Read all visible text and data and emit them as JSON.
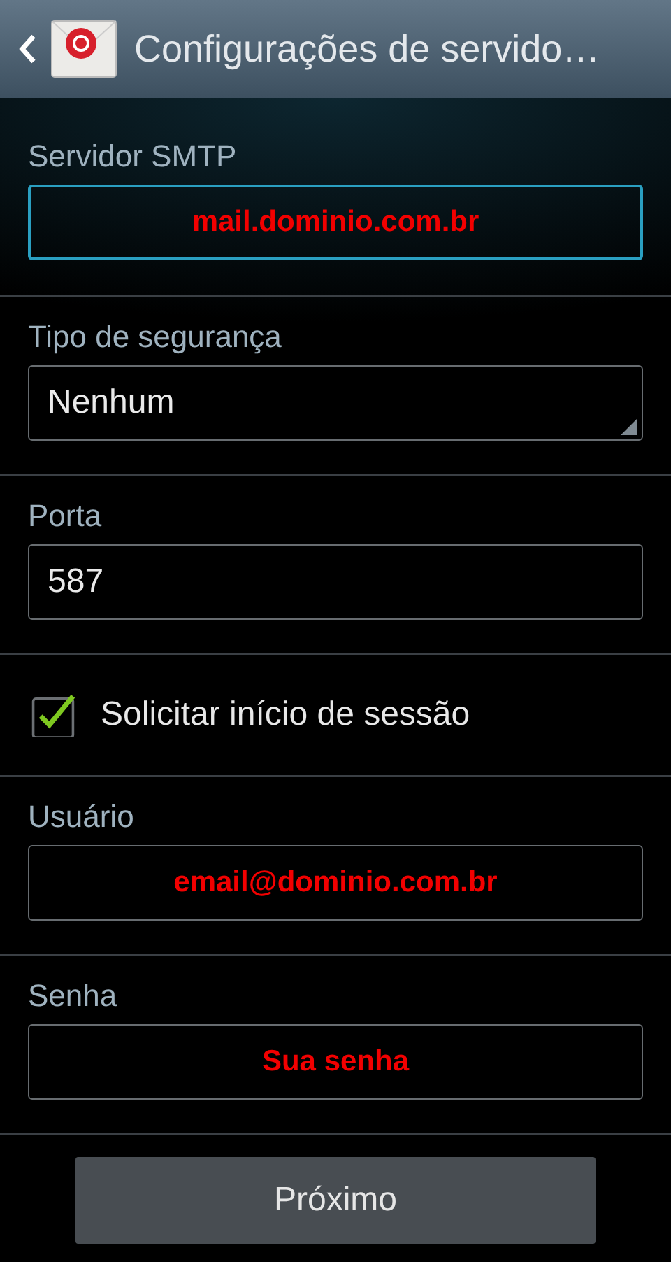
{
  "header": {
    "title": "Configurações de servido…"
  },
  "sections": [
    {
      "kind": "text",
      "label": "Servidor SMTP",
      "value": "mail.dominio.com.br",
      "annotated": true,
      "focused": true
    },
    {
      "kind": "dropdown",
      "label": "Tipo de segurança",
      "value": "Nenhum",
      "annotated": false,
      "focused": false
    },
    {
      "kind": "text",
      "label": "Porta",
      "value": "587",
      "annotated": false,
      "focused": false
    },
    {
      "kind": "checkbox",
      "label": "Solicitar início de sessão",
      "checked": true
    },
    {
      "kind": "text",
      "label": "Usuário",
      "value": "email@dominio.com.br",
      "annotated": true,
      "focused": false
    },
    {
      "kind": "text",
      "label": "Senha",
      "value": "Sua senha",
      "annotated": true,
      "focused": false
    }
  ],
  "footer": {
    "button": "Próximo"
  }
}
